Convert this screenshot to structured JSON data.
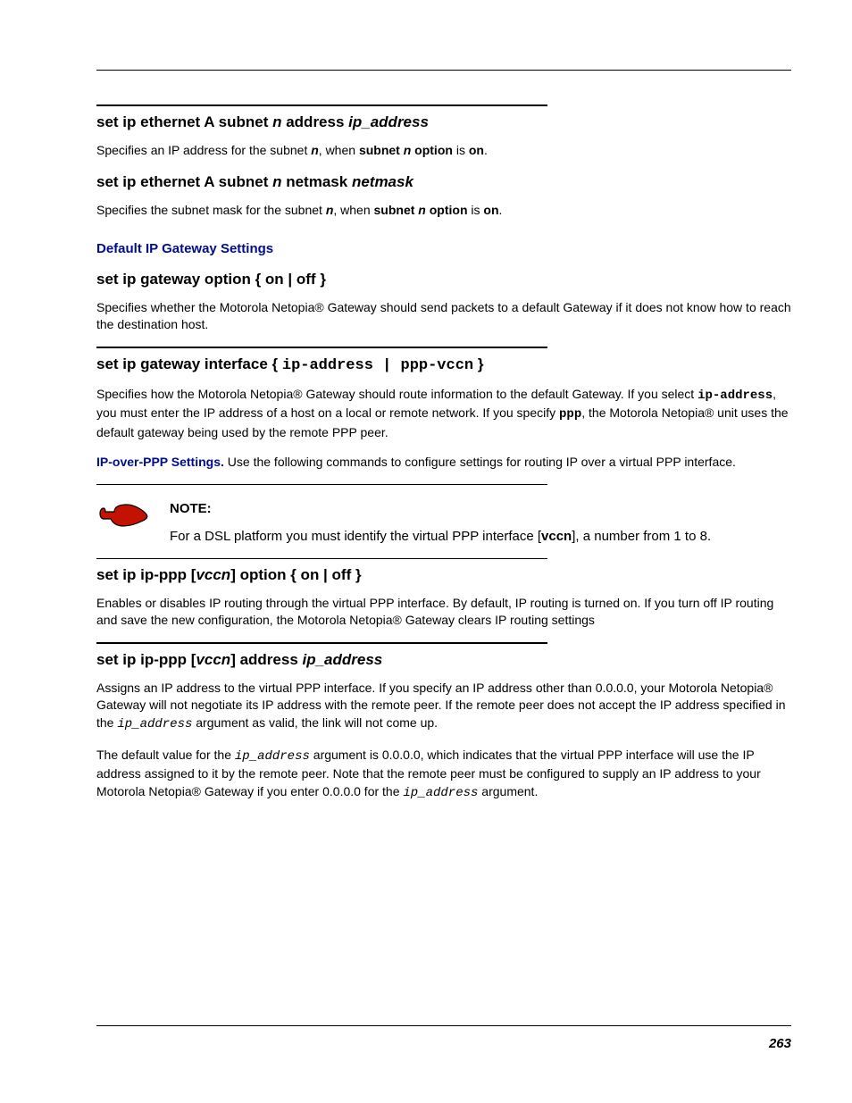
{
  "sections": {
    "s1": {
      "heading_parts": [
        "set ip ethernet A subnet ",
        "n",
        " address ",
        "ip_address"
      ],
      "body_parts": [
        "Specifies an IP address for the subnet ",
        "n",
        ", when ",
        "subnet ",
        "n",
        " option",
        " is ",
        "on",
        "."
      ]
    },
    "s2": {
      "heading_parts": [
        "set ip ethernet A subnet ",
        "n",
        " netmask ",
        "netmask"
      ],
      "body_parts": [
        "Specifies the subnet mask for the subnet ",
        "n",
        ", when ",
        "subnet ",
        "n",
        " option",
        " is ",
        "on",
        "."
      ]
    },
    "sub1": "Default IP Gateway Settings",
    "s3": {
      "heading": "set ip gateway option { on | off }",
      "body": "Specifies whether the Motorola Netopia® Gateway should send packets to a default Gateway if it does not know how to reach the destination host."
    },
    "s4": {
      "heading_parts": [
        "set ip gateway interface { ",
        "ip-address | ppp-vccn",
        " }"
      ],
      "body_parts": [
        "Specifies how the Motorola Netopia® Gateway should route information to the default Gateway. If you select ",
        "ip-address",
        ", you must enter the IP address of a host on a local or remote network. If you specify ",
        "ppp",
        ", the Motorola Netopia® unit uses the default gateway being used by the remote PPP peer."
      ],
      "ip_ppp_label": "IP-over-PPP Settings.",
      "ip_ppp_body": " Use the following commands to configure settings for routing IP over a virtual PPP interface."
    },
    "note": {
      "label": "NOTE:",
      "body_parts": [
        "For a DSL platform you must identify the virtual PPP interface [",
        "vccn",
        "], a number from 1 to 8."
      ]
    },
    "s5": {
      "heading_parts": [
        "set ip ip-ppp [",
        "vccn",
        "] option { on | off }"
      ],
      "body": "Enables or disables IP routing through the virtual PPP interface. By default, IP routing is turned on. If you turn off IP routing and save the new configuration, the Motorola Netopia® Gateway clears IP routing settings"
    },
    "s6": {
      "heading_parts": [
        "set ip ip-ppp [",
        "vccn",
        "] address ",
        "ip_address"
      ],
      "body1_parts": [
        "Assigns an IP address to the virtual PPP interface. If you specify an IP address other than 0.0.0.0, your Motorola Netopia® Gateway will not negotiate its IP address with the remote peer. If the remote peer does not accept the IP address specified in the ",
        "ip_address",
        " argument as valid, the link will not come up."
      ],
      "body2_parts": [
        "The default value for the ",
        "ip_address",
        " argument is 0.0.0.0, which indicates that the virtual PPP interface will use the IP address assigned to it by the remote peer. Note that the remote peer must be configured to supply an IP address to your Motorola Netopia® Gateway if you enter 0.0.0.0 for the ",
        "ip_address",
        " argument."
      ]
    }
  },
  "page_number": "263"
}
